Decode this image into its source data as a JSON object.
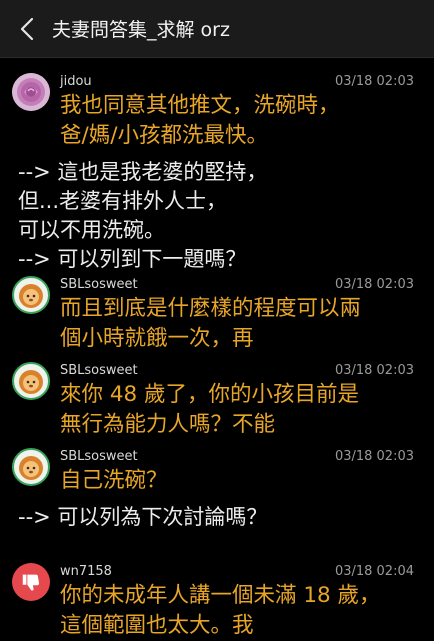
{
  "header": {
    "title": "夫妻問答集_求解 orz"
  },
  "comments": [
    {
      "author": "jidou",
      "time": "03/18 02:03",
      "lines": [
        "我也同意其他推文，洗碗時，",
        "爸/媽/小孩都洗最快。"
      ],
      "reply_lines": [
        "--> 這也是我老婆的堅持，",
        "但...老婆有排外人士，",
        "可以不用洗碗。",
        "--> 可以列到下一題嗎？"
      ]
    },
    {
      "author": "SBLsosweet",
      "time": "03/18 02:03",
      "lines": [
        "而且到底是什麼樣的程度可以兩",
        "個小時就餓一次，再"
      ]
    },
    {
      "author": "SBLsosweet",
      "time": "03/18 02:03",
      "lines": [
        "來你 48 歲了，你的小孩目前是",
        "無行為能力人嗎？不能"
      ]
    },
    {
      "author": "SBLsosweet",
      "time": "03/18 02:03",
      "lines": [
        "自己洗碗？"
      ],
      "reply_lines": [
        "--> 可以列為下次討論嗎？"
      ]
    },
    {
      "author": "wn7158",
      "time": "03/18 02:04",
      "lines": [
        "你的未成年人講一個未滿 18 歲，",
        "這個範圍也太大。我"
      ]
    }
  ],
  "colors": {
    "background": "#000000",
    "push_text": "#e8a628",
    "header": "#1b1b1b",
    "dislike_badge": "#e5484d"
  }
}
